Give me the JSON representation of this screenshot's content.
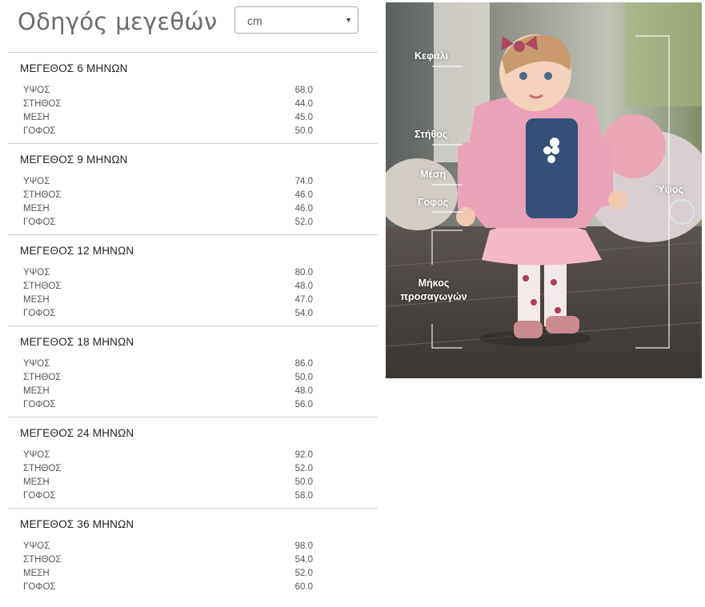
{
  "header": {
    "title": "Οδηγός μεγεθών"
  },
  "unit_select": {
    "value": "cm"
  },
  "sizes": [
    {
      "title": "ΜΕΓΕΘΟΣ 6 ΜΗΝΩΝ",
      "rows": [
        {
          "label": "ΥΨΟΣ",
          "value": "68.0"
        },
        {
          "label": "ΣΤΗΘΟΣ",
          "value": "44.0"
        },
        {
          "label": "ΜΕΣΗ",
          "value": "45.0"
        },
        {
          "label": "ΓΟΦΟΣ",
          "value": "50.0"
        }
      ]
    },
    {
      "title": "ΜΕΓΕΘΟΣ 9 ΜΗΝΩΝ",
      "rows": [
        {
          "label": "ΥΨΟΣ",
          "value": "74.0"
        },
        {
          "label": "ΣΤΗΘΟΣ",
          "value": "46.0"
        },
        {
          "label": "ΜΕΣΗ",
          "value": "46.0"
        },
        {
          "label": "ΓΟΦΟΣ",
          "value": "52.0"
        }
      ]
    },
    {
      "title": "ΜΕΓΕΘΟΣ 12 ΜΗΝΩΝ",
      "rows": [
        {
          "label": "ΥΨΟΣ",
          "value": "80.0"
        },
        {
          "label": "ΣΤΗΘΟΣ",
          "value": "48.0"
        },
        {
          "label": "ΜΕΣΗ",
          "value": "47.0"
        },
        {
          "label": "ΓΟΦΟΣ",
          "value": "54.0"
        }
      ]
    },
    {
      "title": "ΜΕΓΕΘΟΣ 18 ΜΗΝΩΝ",
      "rows": [
        {
          "label": "ΥΨΟΣ",
          "value": "86.0"
        },
        {
          "label": "ΣΤΗΘΟΣ",
          "value": "50.0"
        },
        {
          "label": "ΜΕΣΗ",
          "value": "48.0"
        },
        {
          "label": "ΓΟΦΟΣ",
          "value": "56.0"
        }
      ]
    },
    {
      "title": "ΜΕΓΕΘΟΣ 24 ΜΗΝΩΝ",
      "rows": [
        {
          "label": "ΥΨΟΣ",
          "value": "92.0"
        },
        {
          "label": "ΣΤΗΘΟΣ",
          "value": "52.0"
        },
        {
          "label": "ΜΕΣΗ",
          "value": "50.0"
        },
        {
          "label": "ΓΟΦΟΣ",
          "value": "58.0"
        }
      ]
    },
    {
      "title": "ΜΕΓΕΘΟΣ 36 ΜΗΝΩΝ",
      "rows": [
        {
          "label": "ΥΨΟΣ",
          "value": "98.0"
        },
        {
          "label": "ΣΤΗΘΟΣ",
          "value": "54.0"
        },
        {
          "label": "ΜΕΣΗ",
          "value": "52.0"
        },
        {
          "label": "ΓΟΦΟΣ",
          "value": "60.0"
        }
      ]
    }
  ],
  "photo": {
    "labels": {
      "head": "Κεφάλι",
      "chest": "Στήθος",
      "waist": "Μέση",
      "hip": "Γοφός",
      "height": "Ύψος",
      "inseam": "Μήκος προσαγωγών"
    }
  },
  "colors": {
    "title": "#6b6b6b",
    "divider": "#cfcfcf",
    "label_text": "#ffffff"
  }
}
